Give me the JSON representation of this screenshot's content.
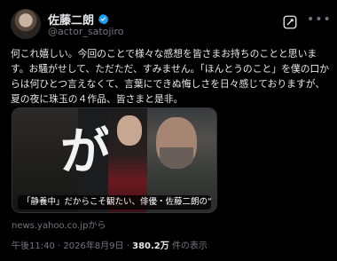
{
  "user": {
    "name": "佐藤二朗",
    "handle": "@actor_satojiro"
  },
  "post": {
    "text": "何これ嬉しい。今回のことで様々な感想を皆さまお持ちのことと思います。お騒がせして、ただただ、すみません。「ほんとうのこと」を僕の口からは何ひとつ言えなくて、言葉にできぬ悔しさを日々感じておりますが、夏の夜に珠玉の４作品、皆さまと是非。"
  },
  "card": {
    "image_text": "が",
    "caption": "「静養中」だからこそ観たい、俳優・佐藤二朗の“怪…",
    "source": "news.yahoo.co.jpから"
  },
  "meta": {
    "time": "午後11:40",
    "date": "2026年8月9日",
    "views_count": "380.2万",
    "views_label": "件の表示"
  },
  "icons": {
    "verified": "verified-badge-icon",
    "grok": "grok-icon",
    "more": "more-options-icon"
  },
  "colors": {
    "background": "#000000",
    "text": "#e7e9ea",
    "secondary": "#71767b",
    "verified": "#1d9bf0"
  }
}
